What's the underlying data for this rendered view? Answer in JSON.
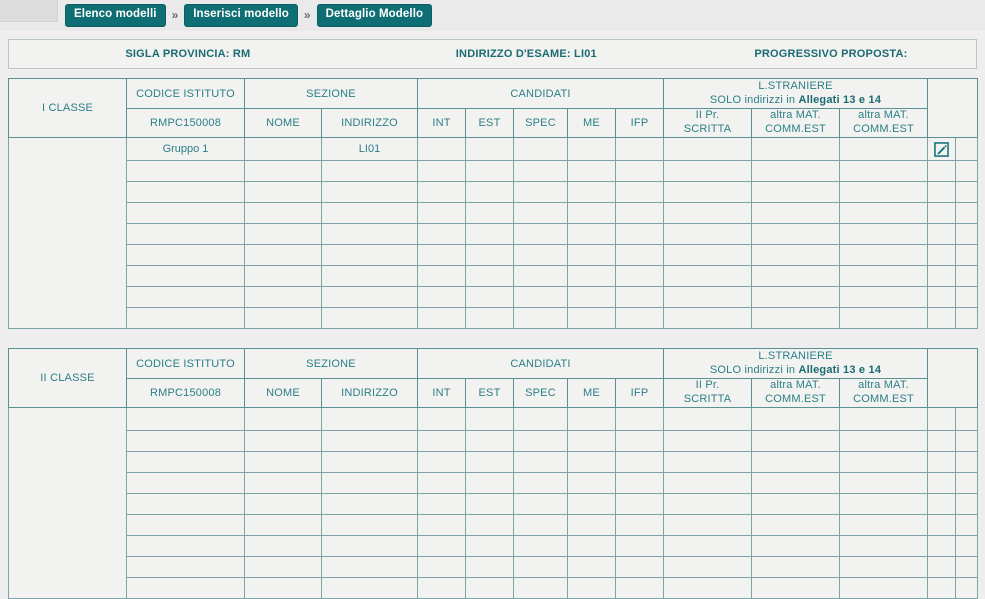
{
  "breadcrumb": {
    "items": [
      {
        "label": "Elenco modelli"
      },
      {
        "label": "Inserisci modello"
      },
      {
        "label": "Dettaglio Modello"
      }
    ],
    "separator": "»"
  },
  "infobar": {
    "provincia": "SIGLA PROVINCIA: RM",
    "indirizzo": "INDIRIZZO D'ESAME: LI01",
    "progressivo": "PROGRESSIVO PROPOSTA:"
  },
  "tables": [
    {
      "id": "tabella-i-classe",
      "header_top": {
        "classe": "I CLASSE",
        "codice_istituto": "CODICE ISTITUTO",
        "sezione": "SEZIONE",
        "candidati": "CANDIDATI",
        "lstraniere_line1": "L.STRANIERE",
        "lstraniere_line2_pre": "SOLO indirizzi in ",
        "lstraniere_line2_bold": "Allegati 13 e 14",
        "actions": ""
      },
      "header_sub": {
        "classe": "",
        "codice": "RMPC150008",
        "nome": "NOME",
        "indirizzo": "INDIRIZZO",
        "int": "INT",
        "est": "EST",
        "spec": "SPEC",
        "me": "ME",
        "ifp": "IFP",
        "pr_scritta_line1": "II Pr.",
        "pr_scritta_line2": "SCRITTA",
        "altra_mat_1_line1": "altra MAT.",
        "altra_mat_1_line2": "COMM.EST",
        "altra_mat_2_line1": "altra MAT.",
        "altra_mat_2_line2": "COMM.EST"
      },
      "rows": [
        {
          "codice": "Gruppo 1",
          "nome": "",
          "indirizzo": "LI01",
          "int": "",
          "est": "",
          "spec": "",
          "me": "",
          "ifp": "",
          "pr_scritta": "",
          "altra_mat_1": "",
          "altra_mat_2": "",
          "action_icon": "edit-icon",
          "action2": ""
        },
        {
          "codice": "",
          "nome": "",
          "indirizzo": "",
          "int": "",
          "est": "",
          "spec": "",
          "me": "",
          "ifp": "",
          "pr_scritta": "",
          "altra_mat_1": "",
          "altra_mat_2": "",
          "action_icon": "",
          "action2": ""
        },
        {
          "codice": "",
          "nome": "",
          "indirizzo": "",
          "int": "",
          "est": "",
          "spec": "",
          "me": "",
          "ifp": "",
          "pr_scritta": "",
          "altra_mat_1": "",
          "altra_mat_2": "",
          "action_icon": "",
          "action2": ""
        },
        {
          "codice": "",
          "nome": "",
          "indirizzo": "",
          "int": "",
          "est": "",
          "spec": "",
          "me": "",
          "ifp": "",
          "pr_scritta": "",
          "altra_mat_1": "",
          "altra_mat_2": "",
          "action_icon": "",
          "action2": ""
        },
        {
          "codice": "",
          "nome": "",
          "indirizzo": "",
          "int": "",
          "est": "",
          "spec": "",
          "me": "",
          "ifp": "",
          "pr_scritta": "",
          "altra_mat_1": "",
          "altra_mat_2": "",
          "action_icon": "",
          "action2": ""
        },
        {
          "codice": "",
          "nome": "",
          "indirizzo": "",
          "int": "",
          "est": "",
          "spec": "",
          "me": "",
          "ifp": "",
          "pr_scritta": "",
          "altra_mat_1": "",
          "altra_mat_2": "",
          "action_icon": "",
          "action2": ""
        },
        {
          "codice": "",
          "nome": "",
          "indirizzo": "",
          "int": "",
          "est": "",
          "spec": "",
          "me": "",
          "ifp": "",
          "pr_scritta": "",
          "altra_mat_1": "",
          "altra_mat_2": "",
          "action_icon": "",
          "action2": ""
        },
        {
          "codice": "",
          "nome": "",
          "indirizzo": "",
          "int": "",
          "est": "",
          "spec": "",
          "me": "",
          "ifp": "",
          "pr_scritta": "",
          "altra_mat_1": "",
          "altra_mat_2": "",
          "action_icon": "",
          "action2": ""
        },
        {
          "codice": "",
          "nome": "",
          "indirizzo": "",
          "int": "",
          "est": "",
          "spec": "",
          "me": "",
          "ifp": "",
          "pr_scritta": "",
          "altra_mat_1": "",
          "altra_mat_2": "",
          "action_icon": "",
          "action2": ""
        }
      ]
    },
    {
      "id": "tabella-ii-classe",
      "header_top": {
        "classe": "II CLASSE",
        "codice_istituto": "CODICE ISTITUTO",
        "sezione": "SEZIONE",
        "candidati": "CANDIDATI",
        "lstraniere_line1": "L.STRANIERE",
        "lstraniere_line2_pre": "SOLO indirizzi in ",
        "lstraniere_line2_bold": "Allegati 13 e 14",
        "actions": ""
      },
      "header_sub": {
        "classe": "",
        "codice": "RMPC150008",
        "nome": "NOME",
        "indirizzo": "INDIRIZZO",
        "int": "INT",
        "est": "EST",
        "spec": "SPEC",
        "me": "ME",
        "ifp": "IFP",
        "pr_scritta_line1": "II Pr.",
        "pr_scritta_line2": "SCRITTA",
        "altra_mat_1_line1": "altra MAT.",
        "altra_mat_1_line2": "COMM.EST",
        "altra_mat_2_line1": "altra MAT.",
        "altra_mat_2_line2": "COMM.EST"
      },
      "rows": [
        {
          "codice": "",
          "nome": "",
          "indirizzo": "",
          "int": "",
          "est": "",
          "spec": "",
          "me": "",
          "ifp": "",
          "pr_scritta": "",
          "altra_mat_1": "",
          "altra_mat_2": "",
          "action_icon": "",
          "action2": ""
        },
        {
          "codice": "",
          "nome": "",
          "indirizzo": "",
          "int": "",
          "est": "",
          "spec": "",
          "me": "",
          "ifp": "",
          "pr_scritta": "",
          "altra_mat_1": "",
          "altra_mat_2": "",
          "action_icon": "",
          "action2": ""
        },
        {
          "codice": "",
          "nome": "",
          "indirizzo": "",
          "int": "",
          "est": "",
          "spec": "",
          "me": "",
          "ifp": "",
          "pr_scritta": "",
          "altra_mat_1": "",
          "altra_mat_2": "",
          "action_icon": "",
          "action2": ""
        },
        {
          "codice": "",
          "nome": "",
          "indirizzo": "",
          "int": "",
          "est": "",
          "spec": "",
          "me": "",
          "ifp": "",
          "pr_scritta": "",
          "altra_mat_1": "",
          "altra_mat_2": "",
          "action_icon": "",
          "action2": ""
        },
        {
          "codice": "",
          "nome": "",
          "indirizzo": "",
          "int": "",
          "est": "",
          "spec": "",
          "me": "",
          "ifp": "",
          "pr_scritta": "",
          "altra_mat_1": "",
          "altra_mat_2": "",
          "action_icon": "",
          "action2": ""
        },
        {
          "codice": "",
          "nome": "",
          "indirizzo": "",
          "int": "",
          "est": "",
          "spec": "",
          "me": "",
          "ifp": "",
          "pr_scritta": "",
          "altra_mat_1": "",
          "altra_mat_2": "",
          "action_icon": "",
          "action2": ""
        },
        {
          "codice": "",
          "nome": "",
          "indirizzo": "",
          "int": "",
          "est": "",
          "spec": "",
          "me": "",
          "ifp": "",
          "pr_scritta": "",
          "altra_mat_1": "",
          "altra_mat_2": "",
          "action_icon": "",
          "action2": ""
        },
        {
          "codice": "",
          "nome": "",
          "indirizzo": "",
          "int": "",
          "est": "",
          "spec": "",
          "me": "",
          "ifp": "",
          "pr_scritta": "",
          "altra_mat_1": "",
          "altra_mat_2": "",
          "action_icon": "",
          "action2": ""
        },
        {
          "codice": "",
          "nome": "",
          "indirizzo": "",
          "int": "",
          "est": "",
          "spec": "",
          "me": "",
          "ifp": "",
          "pr_scritta": "",
          "altra_mat_1": "",
          "altra_mat_2": "",
          "action_icon": "",
          "action2": ""
        }
      ]
    }
  ],
  "colors": {
    "accent": "#0e6e73",
    "text_teal": "#2b7f88",
    "header_teal": "#1b6b73",
    "border": "#7fa3a6",
    "cell_bg": "#f2f2f0",
    "page_bg": "#eeeeee"
  }
}
